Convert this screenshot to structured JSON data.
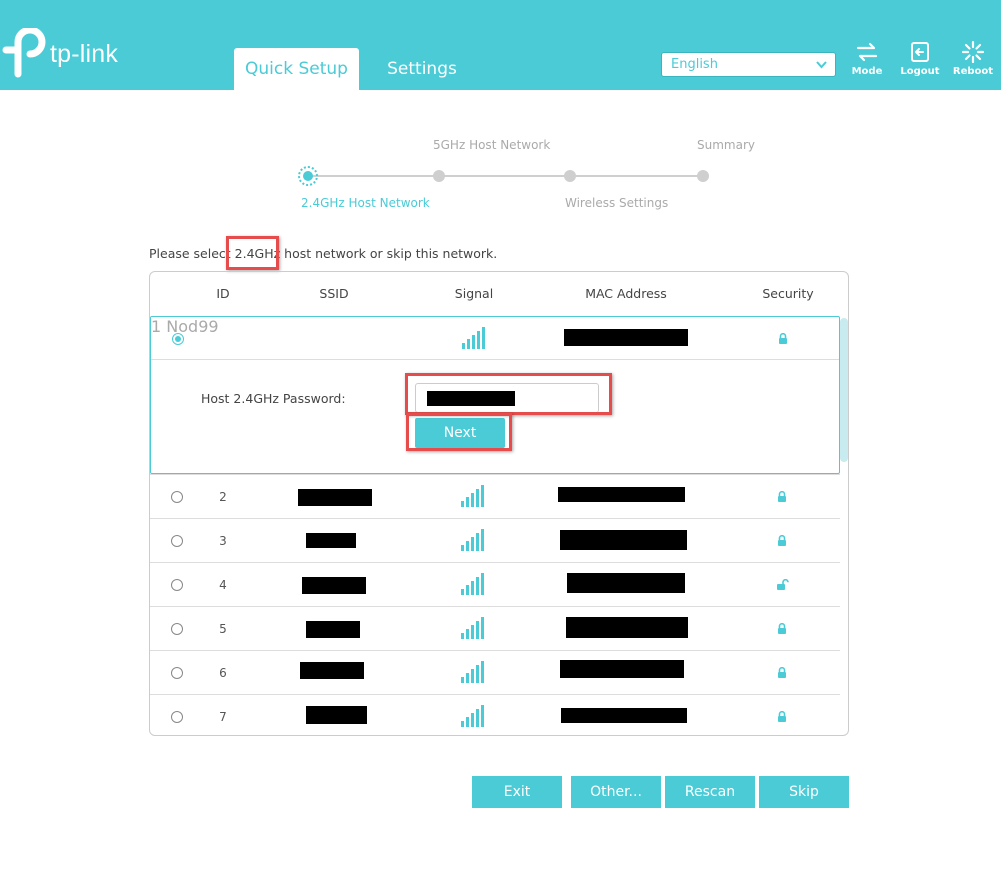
{
  "header": {
    "logo_text": "tp-link",
    "tabs": [
      {
        "label": "Quick Setup"
      },
      {
        "label": "Settings"
      }
    ],
    "language": {
      "selected": "English"
    },
    "buttons": {
      "mode": "Mode",
      "logout": "Logout",
      "reboot": "Reboot"
    }
  },
  "steps": [
    {
      "label": "2.4GHz Host Network",
      "state": "active"
    },
    {
      "label": "5GHz Host Network",
      "state": "pending"
    },
    {
      "label": "Wireless Settings",
      "state": "pending"
    },
    {
      "label": "Summary",
      "state": "pending"
    }
  ],
  "instruction": {
    "before": "Please select ",
    "highlight": "2.4GHz",
    "after": " host network or skip this network."
  },
  "table": {
    "columns": {
      "id": "ID",
      "ssid": "SSID",
      "signal": "Signal",
      "mac": "MAC Address",
      "security": "Security"
    },
    "rows": [
      {
        "id": "1",
        "ssid": "Nod99",
        "selected": true,
        "locked": true
      },
      {
        "id": "2",
        "ssid": "",
        "selected": false,
        "locked": true
      },
      {
        "id": "3",
        "ssid": "",
        "selected": false,
        "locked": true
      },
      {
        "id": "4",
        "ssid": "",
        "selected": false,
        "locked": false
      },
      {
        "id": "5",
        "ssid": "",
        "selected": false,
        "locked": true
      },
      {
        "id": "6",
        "ssid": "",
        "selected": false,
        "locked": true
      },
      {
        "id": "7",
        "ssid": "",
        "selected": false,
        "locked": true
      }
    ],
    "password_label": "Host 2.4GHz Password:",
    "next_label": "Next"
  },
  "footer_buttons": {
    "exit": "Exit",
    "other": "Other...",
    "rescan": "Rescan",
    "skip": "Skip"
  },
  "colors": {
    "accent": "#4acbd6",
    "highlight": "#e74c4c"
  }
}
